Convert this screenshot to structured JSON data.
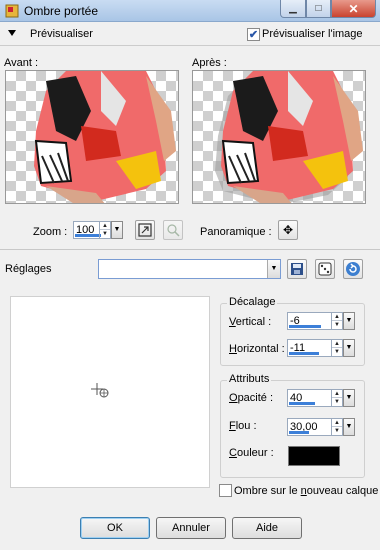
{
  "window": {
    "title": "Ombre portée",
    "minimize_glyph": "▁",
    "maximize_glyph": "□",
    "close_glyph": "✕"
  },
  "preview": {
    "toggle_label": "Prévisualiser",
    "checkbox_label": "Prévisualiser l'image",
    "checkbox_checked": true,
    "checkbox_glyph": "✔",
    "before_label": "Avant :",
    "after_label": "Après :"
  },
  "zoom": {
    "label": "Zoom :",
    "value": "100"
  },
  "panoramique": {
    "label": "Panoramique :",
    "glyph": "✥"
  },
  "reglages": {
    "label": "Réglages",
    "value": ""
  },
  "decalage": {
    "title": "Décalage",
    "vertical": {
      "label_first": "V",
      "label_rest": "ertical :",
      "value": "-6"
    },
    "horizontal": {
      "label_first": "H",
      "label_rest": "orizontal :",
      "value": "-11"
    }
  },
  "attributs": {
    "title": "Attributs",
    "opacite": {
      "label_first": "O",
      "label_rest": "pacité :",
      "value": "40"
    },
    "flou": {
      "label_first": "F",
      "label_rest": "lou :",
      "value": "30,00"
    },
    "couleur": {
      "label_first": "C",
      "label_rest": "ouleur :",
      "color": "#000000"
    }
  },
  "ombre_calque": {
    "label_before": "Ombre sur le ",
    "label_underlined": "n",
    "label_after": "ouveau calque",
    "checked": false
  },
  "buttons": {
    "ok": "OK",
    "cancel": "Annuler",
    "help": "Aide"
  },
  "colors": {
    "accent": "#3c7fd8",
    "titlebar": "#b8d0ee"
  }
}
